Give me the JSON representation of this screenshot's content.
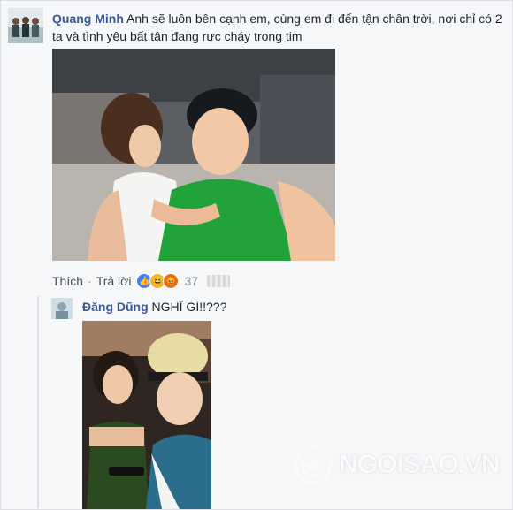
{
  "comment": {
    "author": "Quang Minh",
    "text": "Anh sẽ luôn bên cạnh em, cùng em đi đến tận chân trời, nơi chỉ có 2 ta và tình yêu bất tận đang rực cháy trong tim"
  },
  "actions": {
    "like_label": "Thích",
    "separator": "·",
    "reply_label": "Trả lời",
    "reaction_count": "37",
    "reactions": [
      "like-icon",
      "haha-icon",
      "angry-icon"
    ]
  },
  "reply": {
    "author": "Đăng Dũng",
    "text": "NGHĨ GÌ!!???"
  },
  "watermark": {
    "text": "NGOISAO.VN"
  },
  "colors": {
    "author_link": "#385898",
    "like_blue": "#4080ff",
    "haha_yellow": "#f7b125"
  }
}
